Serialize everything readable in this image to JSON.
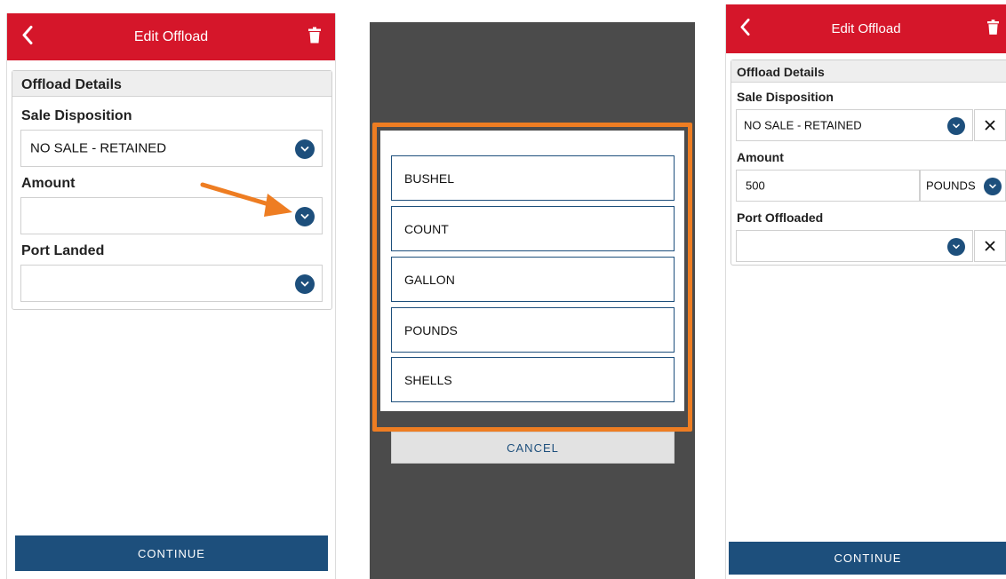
{
  "left_screen": {
    "header": {
      "title": "Edit Offload"
    },
    "card_title": "Offload Details",
    "sale_disposition": {
      "label": "Sale Disposition",
      "value": "NO SALE - RETAINED"
    },
    "amount": {
      "label": "Amount",
      "value": ""
    },
    "port": {
      "label": "Port Landed",
      "value": ""
    },
    "continue_label": "CONTINUE"
  },
  "picker_screen": {
    "options": [
      "BUSHEL",
      "COUNT",
      "GALLON",
      "POUNDS",
      "SHELLS"
    ],
    "cancel_label": "CANCEL"
  },
  "right_screen": {
    "header": {
      "title": "Edit Offload"
    },
    "card_title": "Offload Details",
    "sale_disposition": {
      "label": "Sale Disposition",
      "value": "NO SALE - RETAINED"
    },
    "amount": {
      "label": "Amount",
      "value": "500",
      "unit": "POUNDS"
    },
    "port": {
      "label": "Port Offloaded",
      "value": ""
    },
    "continue_label": "CONTINUE"
  },
  "colors": {
    "header_red": "#d5162a",
    "primary_blue": "#1d4f7c",
    "highlight_orange": "#ee7d22",
    "overlay_gray": "#4b4b4b"
  },
  "icons": [
    "back-chevron-icon",
    "trash-icon",
    "chevron-down-icon",
    "close-icon",
    "arrow-annotation-icon"
  ]
}
